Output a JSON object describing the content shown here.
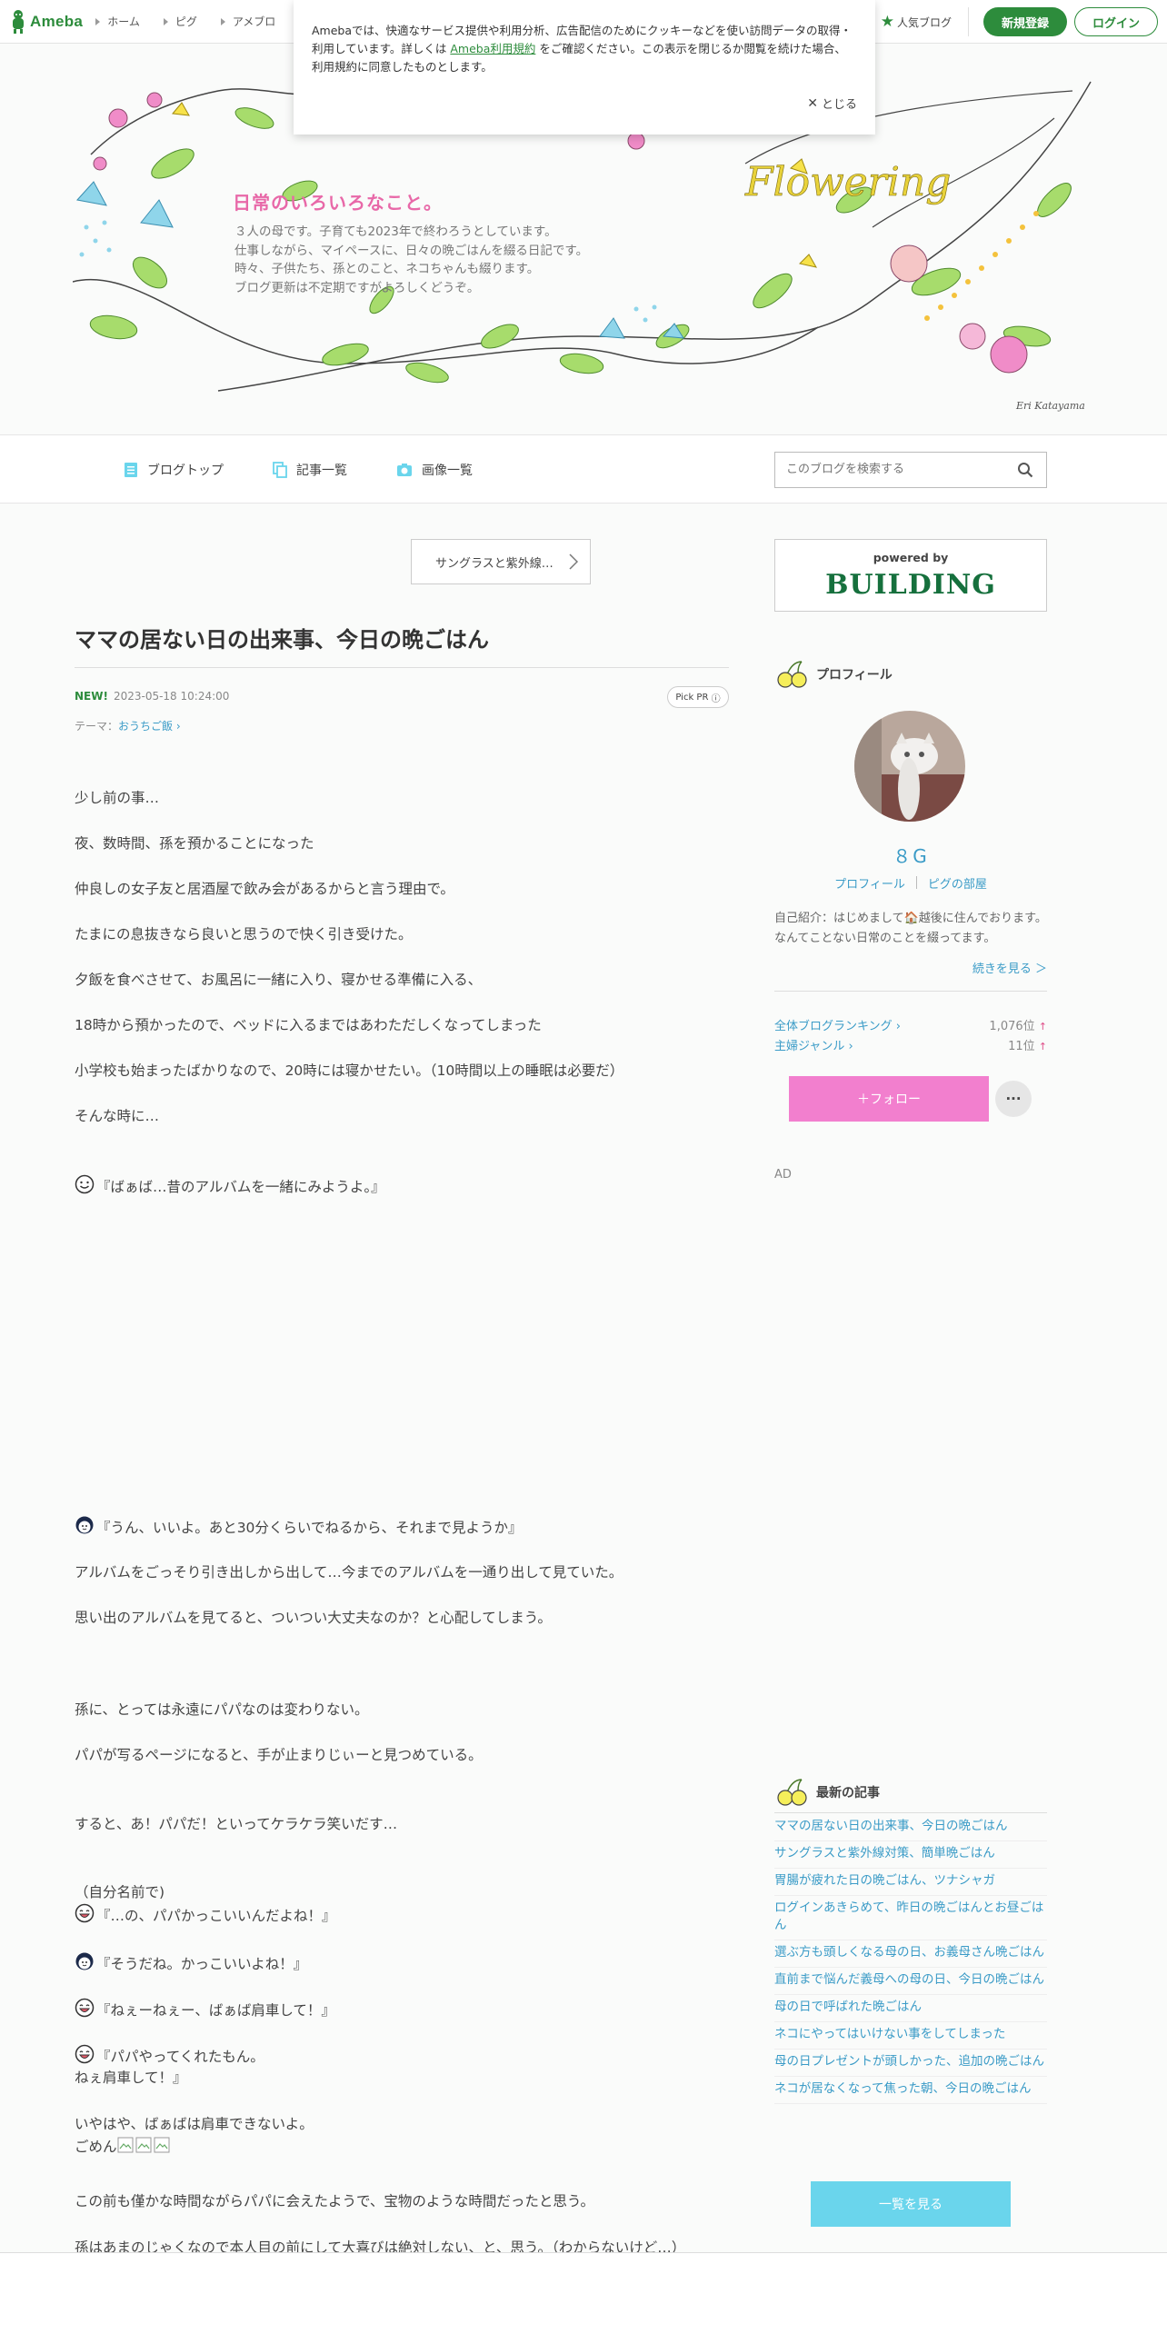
{
  "brand": {
    "name": "Ameba"
  },
  "global_nav": [
    {
      "label": "ホーム"
    },
    {
      "label": "ピグ"
    },
    {
      "label": "アメブロ"
    }
  ],
  "topbar": {
    "popular_label": "人気ブログ",
    "register_label": "新規登録",
    "login_label": "ログイン"
  },
  "cookie": {
    "text_before": "Amebaでは、快適なサービス提供や利用分析、広告配信のためにクッキーなどを使い訪問データの取得・利用しています。詳しくは ",
    "link_text": "Ameba利用規約",
    "text_after": " をご確認ください。この表示を閉じるか閲覧を続けた場合、利用規約に同意したものとします。",
    "close_label": "とじる"
  },
  "blog_header": {
    "title": "日常のいろいろなこと。",
    "description": [
      "３人の母です。子育ても2023年で終わろうとしています。",
      "仕事しながら、マイペースに、日々の晩ごはんを綴る日記です。",
      "時々、子供たち、孫とのこと、ネコちゃんも綴ります。",
      "ブログ更新は不定期ですがよろしくどうぞ。"
    ],
    "art_text": "Flowering",
    "signature": "Eri Katayama"
  },
  "blog_nav": {
    "items": [
      {
        "label": "ブログトップ",
        "icon": "document-icon"
      },
      {
        "label": "記事一覧",
        "icon": "copy-icon"
      },
      {
        "label": "画像一覧",
        "icon": "camera-icon"
      }
    ],
    "search_placeholder": "このブログを検索する"
  },
  "article": {
    "prev_label": "サングラスと紫外線…",
    "title": "ママの居ない日の出来事、今日の晩ごはん",
    "new_label": "NEW!",
    "date": "2023-05-18 10:24:00",
    "pickpr_label": "Pick PR",
    "theme_prefix": "テーマ：",
    "theme_name": "おうちご飯",
    "paragraphs": [
      "少し前の事…",
      "夜、数時間、孫を預かることになった",
      "仲良しの女子友と居酒屋で飲み会があるからと言う理由で。",
      "たまにの息抜きなら良いと思うので快く引き受けた。",
      "夕飯を食べさせて、お風呂に一緒に入り、寝かせる準備に入る、",
      "18時から預かったので、ベッドに入るまではあわただしくなってしまった",
      "小学校も始まったばかりなので、20時には寝かせたい。（10時間以上の睡眠は必要だ）",
      "そんな時に…",
      "『ばぁば…昔のアルバムを一緒にみようよ。』",
      "『うん、いいよ。あと30分くらいでねるから、それまで見ようか』",
      "アルバムをごっそり引き出しから出して…今までのアルバムを一通り出して見ていた。",
      "思い出のアルバムを見てると、ついつい大丈夫なのか？と心配してしまう。",
      "孫に、とっては永遠にパパなのは変わりない。",
      "パパが写るページになると、手が止まりじぃーと見つめている。",
      "すると、あ！パパだ！といってケラケラ笑いだす…",
      "（自分名前で)",
      "『…の、パパかっこいいんだよね！』",
      "『そうだね。かっこいいよね！』",
      "『ねぇーねぇー、ばぁば肩車して！』",
      "『パパやってくれたもん。",
      "ねぇ肩車して！』",
      "いやはや、ばぁばは肩車できないよ。",
      "ごめん",
      "この前も僅かな時間ながらパパに会えたようで、宝物のような時間だったと思う。",
      "孫はあまのじゃくなので本人目の前にして大喜びは絶対しない、と、思う。（わからないけど…）"
    ]
  },
  "sidebar": {
    "building_sub": "powered by",
    "building_main": "BUILDING",
    "profile_heading": "プロフィール",
    "nickname": "８G",
    "profile_link": "プロフィール",
    "pig_room_link": "ピグの部屋",
    "intro": "自己紹介：はじめまして🏠越後に住んでおります。 なんてことない日常のことを綴ってます。",
    "read_more": "続きを見る ＞",
    "rankings": [
      {
        "label": "全体ブログランキング",
        "value": "1,076位",
        "arrow": "↑"
      },
      {
        "label": "主婦ジャンル",
        "value": "11位",
        "arrow": "↑"
      }
    ],
    "follow_label": "＋フォロー",
    "more_label": "···",
    "ad_label": "AD",
    "recent_heading": "最新の記事",
    "recent_articles": [
      "ママの居ない日の出来事、今日の晩ごはん",
      "サングラスと紫外線対策、簡単晩ごはん",
      "胃腸が疲れた日の晩ごはん、ツナシャガ",
      "ログインあきらめて、昨日の晩ごはんとお昼ごはん",
      "選ぶ方も頭しくなる母の日、お義母さん晩ごはん",
      "直前まで悩んだ義母への母の日、今日の晩ごはん",
      "母の日で呼ばれた晩ごはん",
      "ネコにやってはいけない事をしてしまった",
      "母の日プレゼントが頭しかった、追加の晩ごはん",
      "ネコが居なくなって焦った朝、今日の晩ごはん"
    ],
    "see_all_label": "一覧を見る"
  },
  "colors": {
    "ameba_green": "#2d8c3c",
    "link_blue": "#3a9bc7",
    "follow_pink": "#f27fce",
    "see_all_cyan": "#6ad5ec",
    "title_pink": "#e868a8"
  }
}
